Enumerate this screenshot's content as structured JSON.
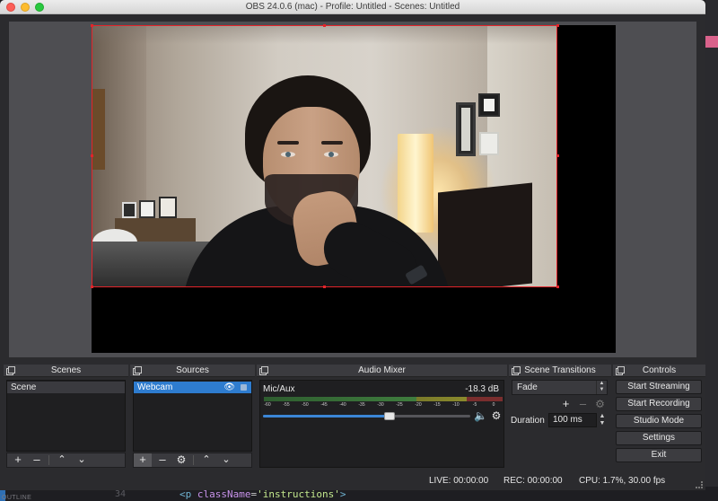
{
  "window": {
    "title": "OBS 24.0.6 (mac) - Profile: Untitled - Scenes: Untitled"
  },
  "docks": {
    "scenes": {
      "title": "Scenes",
      "items": [
        {
          "label": "Scene",
          "selected": true
        }
      ]
    },
    "sources": {
      "title": "Sources",
      "items": [
        {
          "label": "Webcam",
          "selected": true,
          "visible_icon": "eye-icon",
          "lock_icon": "lock-icon"
        }
      ]
    },
    "audio_mixer": {
      "title": "Audio Mixer",
      "channels": [
        {
          "name": "Mic/Aux",
          "level_db": "-18.3 dB",
          "volume_fraction": 0.61,
          "scale_ticks": [
            "-60",
            "-55",
            "-50",
            "-45",
            "-40",
            "-35",
            "-30",
            "-25",
            "-20",
            "-15",
            "-10",
            "-5",
            "0"
          ]
        }
      ]
    },
    "scene_transitions": {
      "title": "Scene Transitions",
      "selected_transition": "Fade",
      "duration_label": "Duration",
      "duration_value": "100 ms"
    },
    "controls": {
      "title": "Controls",
      "buttons": [
        "Start Streaming",
        "Start Recording",
        "Studio Mode",
        "Settings",
        "Exit"
      ]
    }
  },
  "status": {
    "live": "LIVE: 00:00:00",
    "rec": "REC: 00:00:00",
    "cpu": "CPU: 1.7%, 30.00 fps"
  },
  "background_editor": {
    "outline_label": "OUTLINE",
    "line_number": "34",
    "code_tag_open": "<p",
    "code_attr": "className",
    "code_value": "'instructions'",
    "code_tag_close": ">"
  },
  "colors": {
    "selection_red": "#e2242a",
    "selected_source_blue": "#2e7ccf",
    "volume_blue": "#3b86d6"
  }
}
